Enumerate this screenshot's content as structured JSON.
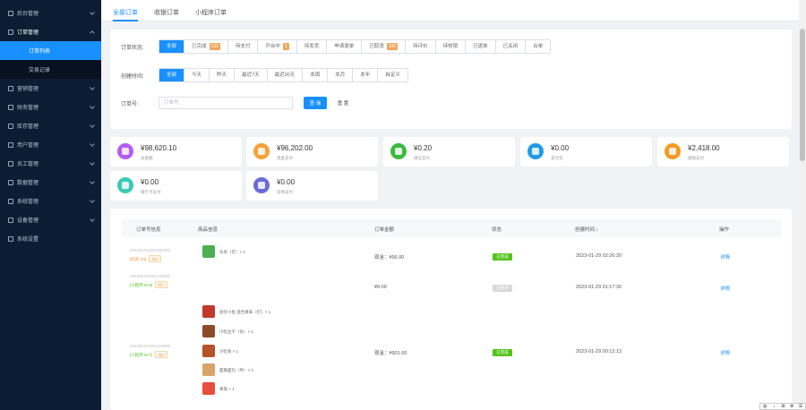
{
  "sidebar": {
    "items": [
      {
        "label": "后台管理"
      },
      {
        "label": "订单管理"
      },
      {
        "label": "订单列表"
      },
      {
        "label": "交易记录"
      },
      {
        "label": "营销管理"
      },
      {
        "label": "财务管理"
      },
      {
        "label": "库存管理"
      },
      {
        "label": "用户管理"
      },
      {
        "label": "员工管理"
      },
      {
        "label": "数据管理"
      },
      {
        "label": "系统管理"
      },
      {
        "label": "设备管理"
      },
      {
        "label": "系统设置"
      }
    ]
  },
  "tabs": [
    "全部订单",
    "收银订单",
    "小程序订单"
  ],
  "filters": {
    "status_label": "订单状态:",
    "status_options": [
      {
        "label": "全部",
        "badge": ""
      },
      {
        "label": "已完成",
        "badge": "135"
      },
      {
        "label": "待支付",
        "badge": ""
      },
      {
        "label": "开台中",
        "badge": "1"
      },
      {
        "label": "待发货",
        "badge": ""
      },
      {
        "label": "申请退单",
        "badge": ""
      },
      {
        "label": "已取消",
        "badge": "106"
      },
      {
        "label": "待评价",
        "badge": ""
      },
      {
        "label": "待核销",
        "badge": ""
      },
      {
        "label": "已退单",
        "badge": ""
      },
      {
        "label": "已关闭",
        "badge": ""
      },
      {
        "label": "合单",
        "badge": ""
      }
    ],
    "time_label": "创建时间:",
    "time_options": [
      "全部",
      "今天",
      "昨天",
      "最近7天",
      "最近30天",
      "本周",
      "本月",
      "本年",
      "自定义"
    ],
    "order_no_label": "订单号:",
    "order_no_placeholder": "订单号",
    "search_button": "查 询",
    "reset_button": "重 置"
  },
  "stats": [
    {
      "value": "¥98,620.10",
      "label": "总金额",
      "color": "#b15cf2"
    },
    {
      "value": "¥96,202.00",
      "label": "现金支付",
      "color": "#f5a23a"
    },
    {
      "value": "¥0.20",
      "label": "微信支付",
      "color": "#3cb93c"
    },
    {
      "value": "¥0.00",
      "label": "支付宝",
      "color": "#1e9be8"
    },
    {
      "value": "¥2,418.00",
      "label": "储值支付",
      "color": "#f59a22"
    },
    {
      "value": "¥0.00",
      "label": "银行卡支付",
      "color": "#3cc9b6"
    },
    {
      "value": "¥0.00",
      "label": "其他支付",
      "color": "#6b6bd8"
    }
  ],
  "table": {
    "headers": [
      "订单号信息",
      "商品信息",
      "订单金额",
      "状态",
      "创建时间 ↕",
      "操作"
    ],
    "rows": [
      {
        "order_no": "202301291002262000",
        "source": "[包房 S4]",
        "seat": "B2",
        "goods": [
          {
            "name": "乐虎（打）× 1",
            "color": "#4caf50"
          }
        ],
        "amount": "现金：¥96.00",
        "status": "已完成",
        "time": "2023-01-29 02:26:20",
        "action": "详情"
      },
      {
        "order_no": "202301291001730000",
        "source": "[小程序 M-6]",
        "seat": "B7",
        "goods": [],
        "amount": "¥0.00",
        "status": "已取消",
        "time": "2023-01-29 01:17:30",
        "action": "详情"
      },
      {
        "order_no": "202301291001219000",
        "source": "[小程序 M-7]",
        "seat": "B6",
        "goods": [
          {
            "name": "劲仔小鱼 混合果味（打）× 1",
            "color": "#c0392b"
          },
          {
            "name": "冷吃豆干（份）× 1",
            "color": "#8e4b2a"
          },
          {
            "name": "冷吃兔 × 1",
            "color": "#b5522a"
          },
          {
            "name": "面筋面包（件）× 2",
            "color": "#d8a46a"
          },
          {
            "name": "果盘 × 1",
            "color": "#e74c3c"
          }
        ],
        "amount": "现金：¥901.00",
        "status": "已完成",
        "time": "2023-01-29 00:12:13",
        "action": "详情"
      }
    ]
  },
  "mini_toolbar": [
    "中",
    "・",
    "⊞",
    "⚙",
    "☰"
  ]
}
